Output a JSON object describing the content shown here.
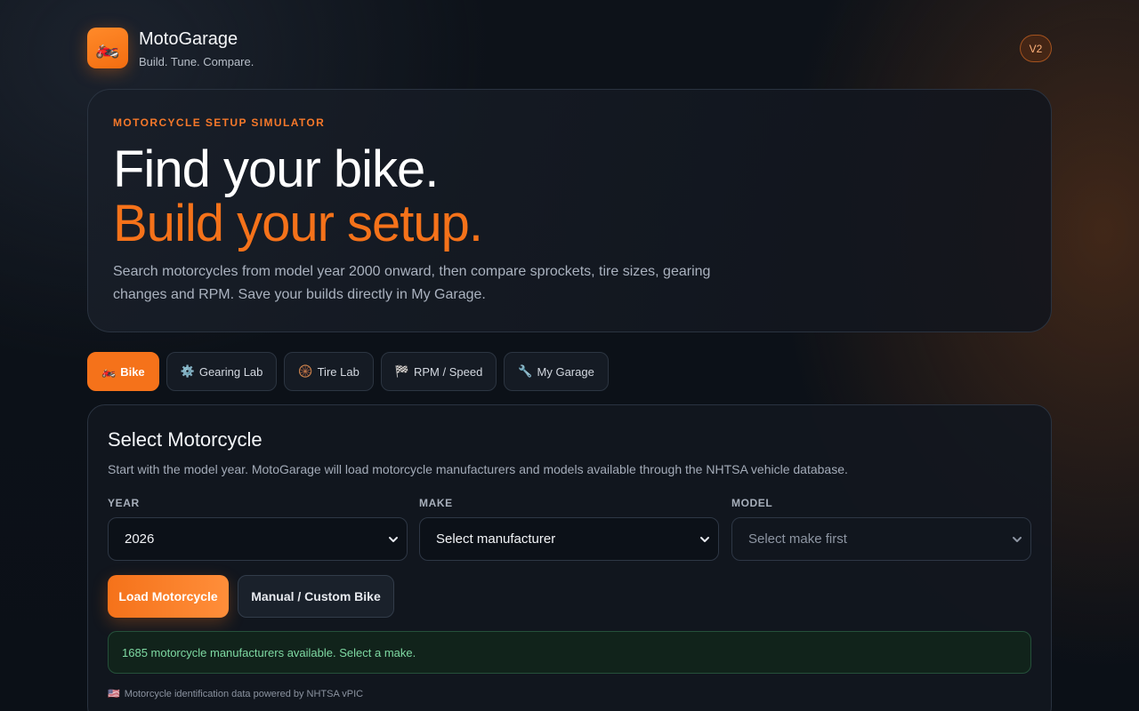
{
  "header": {
    "logo_icon": "🏍️",
    "title": "MotoGarage",
    "subtitle": "Build. Tune. Compare.",
    "version": "V2"
  },
  "hero": {
    "eyebrow": "MOTORCYCLE SETUP SIMULATOR",
    "line1": "Find your bike.",
    "line2": "Build your setup.",
    "description": "Search motorcycles from model year 2000 onward, then compare sprockets, tire sizes, gearing changes and RPM. Save your builds directly in My Garage."
  },
  "tabs": [
    {
      "icon": "🏍️",
      "label": "Bike",
      "active": true
    },
    {
      "icon": "⚙️",
      "label": "Gearing Lab",
      "active": false
    },
    {
      "icon": "🛞",
      "label": "Tire Lab",
      "active": false
    },
    {
      "icon": "🏁",
      "label": "RPM / Speed",
      "active": false
    },
    {
      "icon": "🔧",
      "label": "My Garage",
      "active": false
    }
  ],
  "select_card": {
    "title": "Select Motorcycle",
    "description": "Start with the model year. MotoGarage will load motorcycle manufacturers and models available through the NHTSA vehicle database.",
    "year_label": "YEAR",
    "year_value": "2026",
    "make_label": "MAKE",
    "make_value": "Select manufacturer",
    "model_label": "MODEL",
    "model_value": "Select make first",
    "load_button": "Load Motorcycle",
    "custom_button": "Manual / Custom Bike",
    "status": "1685 motorcycle manufacturers available. Select a make.",
    "credit_flag": "🇺🇸",
    "credit": "Motorcycle identification data powered by NHTSA vPIC"
  },
  "colors": {
    "accent": "#f5721a",
    "success_text": "#7ed9a2",
    "background": "#0b1017"
  }
}
